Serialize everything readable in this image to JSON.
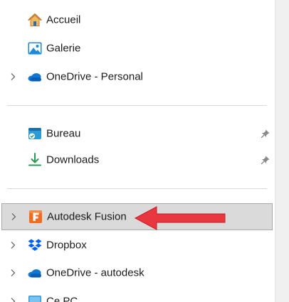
{
  "nav": {
    "accueil": "Accueil",
    "galerie": "Galerie",
    "onedrive_personal": "OneDrive - Personal",
    "bureau": "Bureau",
    "downloads": "Downloads",
    "autodesk_fusion": "Autodesk Fusion",
    "dropbox": "Dropbox",
    "onedrive_autodesk": "OneDrive - autodesk",
    "ce_pc": "Ce PC"
  },
  "icons": {
    "accueil": "home-icon",
    "galerie": "gallery-icon",
    "onedrive_personal": "onedrive-cloud-icon",
    "bureau": "desktop-icon",
    "downloads": "download-icon",
    "autodesk_fusion": "fusion-icon",
    "dropbox": "dropbox-icon",
    "onedrive_autodesk": "onedrive-cloud-icon",
    "ce_pc": "computer-icon",
    "pin": "pin-icon",
    "expand": "chevron-right-icon"
  },
  "colors": {
    "selected_background": "#dadada",
    "selected_border": "#a9a9a9",
    "annotation_arrow": "#e8373f",
    "fusion_brand": "#f26b21",
    "onedrive_blue": "#0f78d4",
    "dropbox_blue": "#0061fe"
  },
  "state": {
    "selected_item": "Autodesk Fusion"
  }
}
